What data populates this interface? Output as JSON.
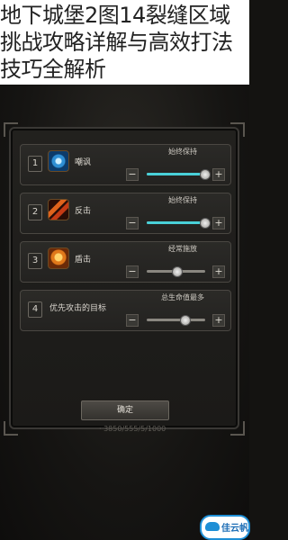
{
  "headline": "地下城堡2图14裂缝区域挑战攻略详解与高效打法技巧全解析",
  "rows": [
    {
      "index": "1",
      "icon": "eye-icon",
      "label": "嘲讽",
      "mode": "始终保持",
      "fill_fraction": 0.98,
      "fill_color": "#49d0d8"
    },
    {
      "index": "2",
      "icon": "sword-icon",
      "label": "反击",
      "mode": "始终保持",
      "fill_fraction": 0.98,
      "fill_color": "#49d0d8"
    },
    {
      "index": "3",
      "icon": "shield-icon",
      "label": "盾击",
      "mode": "经常施放",
      "fill_fraction": 0.5,
      "fill_color": "#49d0d8"
    },
    {
      "index": "4",
      "icon": "",
      "label": "优先攻击的目标",
      "mode": "总生命值最多",
      "fill_fraction": 0.65,
      "fill_color": "#49d0d8"
    }
  ],
  "minus_label": "−",
  "plus_label": "+",
  "confirm_label": "确定",
  "bottom_text": "· 3850/555/5/1000",
  "watermark": "佳云帆"
}
